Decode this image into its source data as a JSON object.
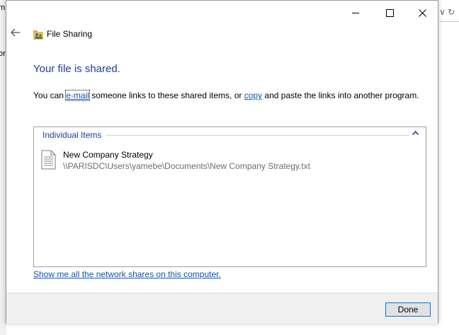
{
  "window": {
    "title": "File Sharing"
  },
  "background": {
    "left_text_1": "m",
    "left_text_2": "or",
    "right_tools": "∨  ↻"
  },
  "main": {
    "heading": "Your file is shared.",
    "instruction_prefix": "You can ",
    "email_link": "e-mail",
    "instruction_mid": " someone links to these shared items, or ",
    "copy_link": "copy",
    "instruction_suffix": " and paste the links into another program."
  },
  "items": {
    "group_label": "Individual Items",
    "files": [
      {
        "name": "New Company Strategy",
        "path": "\\\\PARISDC\\Users\\yamebe\\Documents\\New Company Strategy.txt",
        "icon": "text-file-icon"
      }
    ]
  },
  "network_shares_link": "Show me all the network shares on this computer.",
  "footer": {
    "done_label": "Done"
  },
  "colors": {
    "heading": "#1e3f9c",
    "link": "#0b55b7",
    "path": "#6d6d6d",
    "button_border": "#0078d7"
  }
}
